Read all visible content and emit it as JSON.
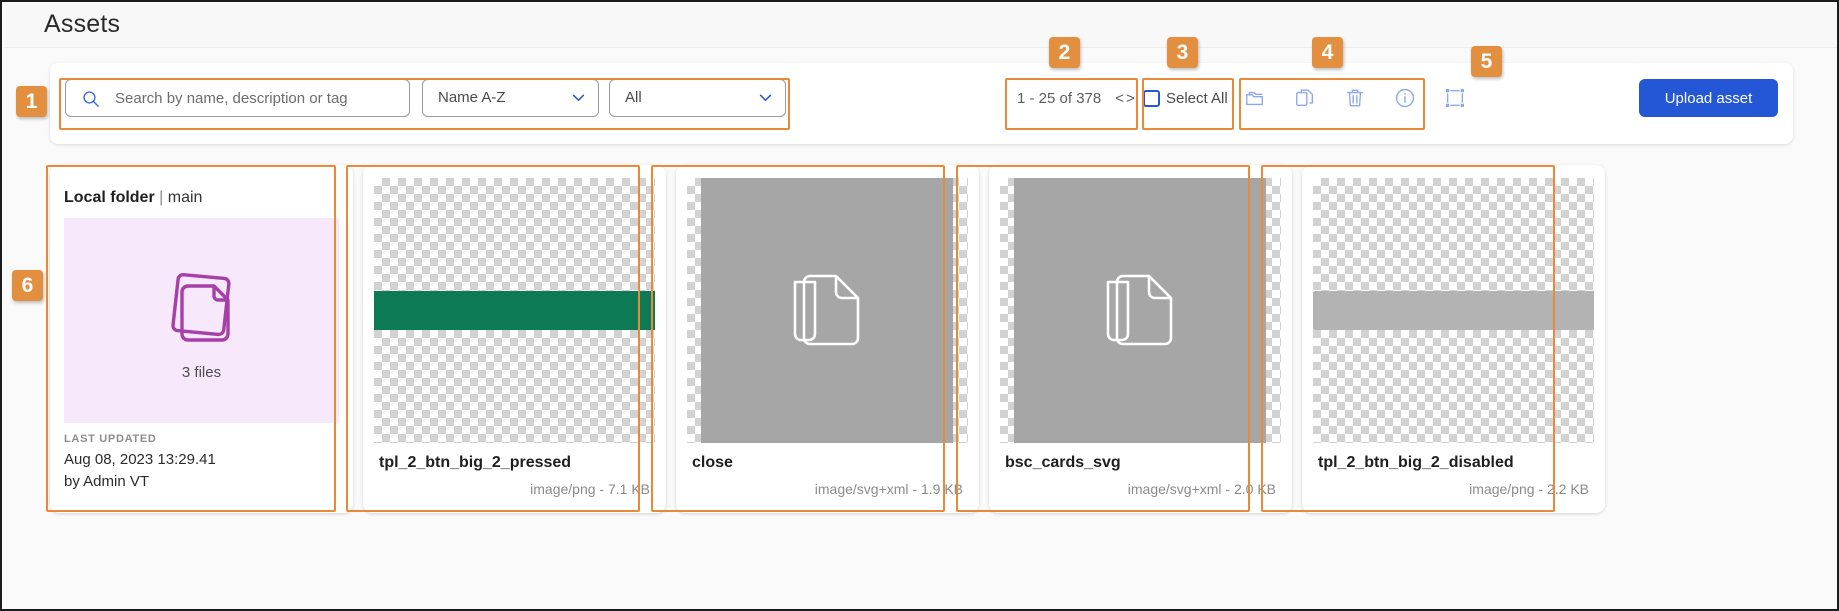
{
  "header": {
    "title": "Assets"
  },
  "toolbar": {
    "search": {
      "placeholder": "Search by name, description or tag",
      "value": "",
      "icon": "search-icon"
    },
    "sort_select": {
      "value": "Name A-Z",
      "icon": "chevron-down-icon"
    },
    "type_select": {
      "value": "All",
      "icon": "chevron-down-icon"
    },
    "pagination": {
      "range": "1 - 25 of 378",
      "prev": "<",
      "next": ">"
    },
    "select_all": {
      "label": "Select All",
      "checked": false
    },
    "icons": [
      {
        "name": "move-to-folder-icon"
      },
      {
        "name": "copy-icon"
      },
      {
        "name": "trash-icon"
      },
      {
        "name": "info-icon"
      },
      {
        "name": "crop-icon"
      }
    ],
    "upload_label": "Upload asset"
  },
  "folder_card": {
    "title_strong": "Local folder",
    "title_separator": " | ",
    "title_branch": "main",
    "files_count": "3 files",
    "meta_label": "LAST UPDATED",
    "meta_date": "Aug 08, 2023 13:29.41",
    "meta_author": "by Admin VT",
    "thumb_bg": "#f7e8fb",
    "icon_color": "#a63fa8"
  },
  "assets": [
    {
      "name": "tpl_2_btn_big_2_pressed",
      "meta": "image/png - 7.1 KB",
      "thumb_type": "checker-bar",
      "bar_color": "#0b7a55"
    },
    {
      "name": "close",
      "meta": "image/svg+xml - 1.9 KB",
      "thumb_type": "solid-doc",
      "fill_color": "#a6a6a6"
    },
    {
      "name": "bsc_cards_svg",
      "meta": "image/svg+xml - 2.0 KB",
      "thumb_type": "solid-doc",
      "fill_color": "#a6a6a6"
    },
    {
      "name": "tpl_2_btn_big_2_disabled",
      "meta": "image/png - 2.2 KB",
      "thumb_type": "checker-bar",
      "bar_color": "#b3b3b3"
    }
  ],
  "annotations": {
    "accent": "#e2903f",
    "badges": [
      "1",
      "2",
      "3",
      "4",
      "5",
      "6"
    ]
  }
}
